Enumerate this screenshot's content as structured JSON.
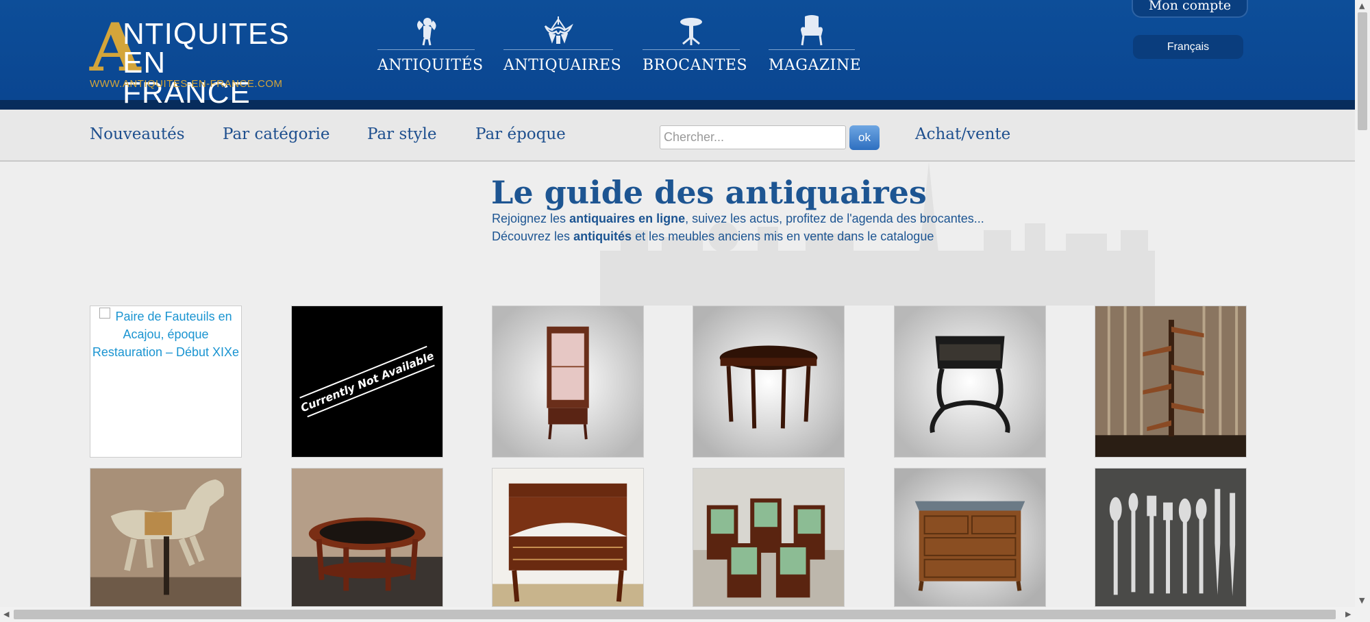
{
  "header": {
    "logo": {
      "initial": "A",
      "line1": "NTIQUITES",
      "line2": "EN FRANCE",
      "url": "WWW.ANTIQUITES-EN-FRANCE.COM"
    },
    "nav": [
      {
        "label": "ANTIQUITÉS",
        "icon": "cherub-icon"
      },
      {
        "label": "ANTIQUAIRES",
        "icon": "chandelier-icon"
      },
      {
        "label": "BROCANTES",
        "icon": "pedestal-table-icon"
      },
      {
        "label": "MAGAZINE",
        "icon": "armchair-icon"
      }
    ],
    "account": "Mon compte",
    "language": "Français"
  },
  "subnav": {
    "items": [
      "Nouveautés",
      "Par catégorie",
      "Par style",
      "Par époque"
    ],
    "search_placeholder": "Chercher...",
    "search_button": "ok",
    "buy_sell": "Achat/vente"
  },
  "hero": {
    "title": "Le guide des antiquaires",
    "line1_pre": "Rejoignez les ",
    "line1_bold": "antiquaires en ligne",
    "line1_post": ", suivez les actus, profitez de l'agenda des brocantes...",
    "line2_pre": "Découvrez les ",
    "line2_bold": "antiquités",
    "line2_post": " et les meubles anciens mis en vente dans le catalogue"
  },
  "products": {
    "row1": [
      {
        "kind": "broken",
        "alt": "Paire de Fauteuils en Acajou, époque Restauration – Début XIXe"
      },
      {
        "kind": "unavailable",
        "text": "Currently Not Available"
      },
      {
        "kind": "vitrine-cabinet"
      },
      {
        "kind": "round-table"
      },
      {
        "kind": "lacquer-side-table"
      },
      {
        "kind": "spiral-staircase"
      }
    ],
    "row2": [
      {
        "kind": "carousel-horse"
      },
      {
        "kind": "oval-coffee-table"
      },
      {
        "kind": "cylinder-desk"
      },
      {
        "kind": "green-armchairs"
      },
      {
        "kind": "chest-of-drawers"
      },
      {
        "kind": "silver-cutlery"
      }
    ]
  },
  "colors": {
    "header_blue": "#0d4e99",
    "gold": "#d4a53a",
    "link_blue": "#1e4f8e"
  }
}
